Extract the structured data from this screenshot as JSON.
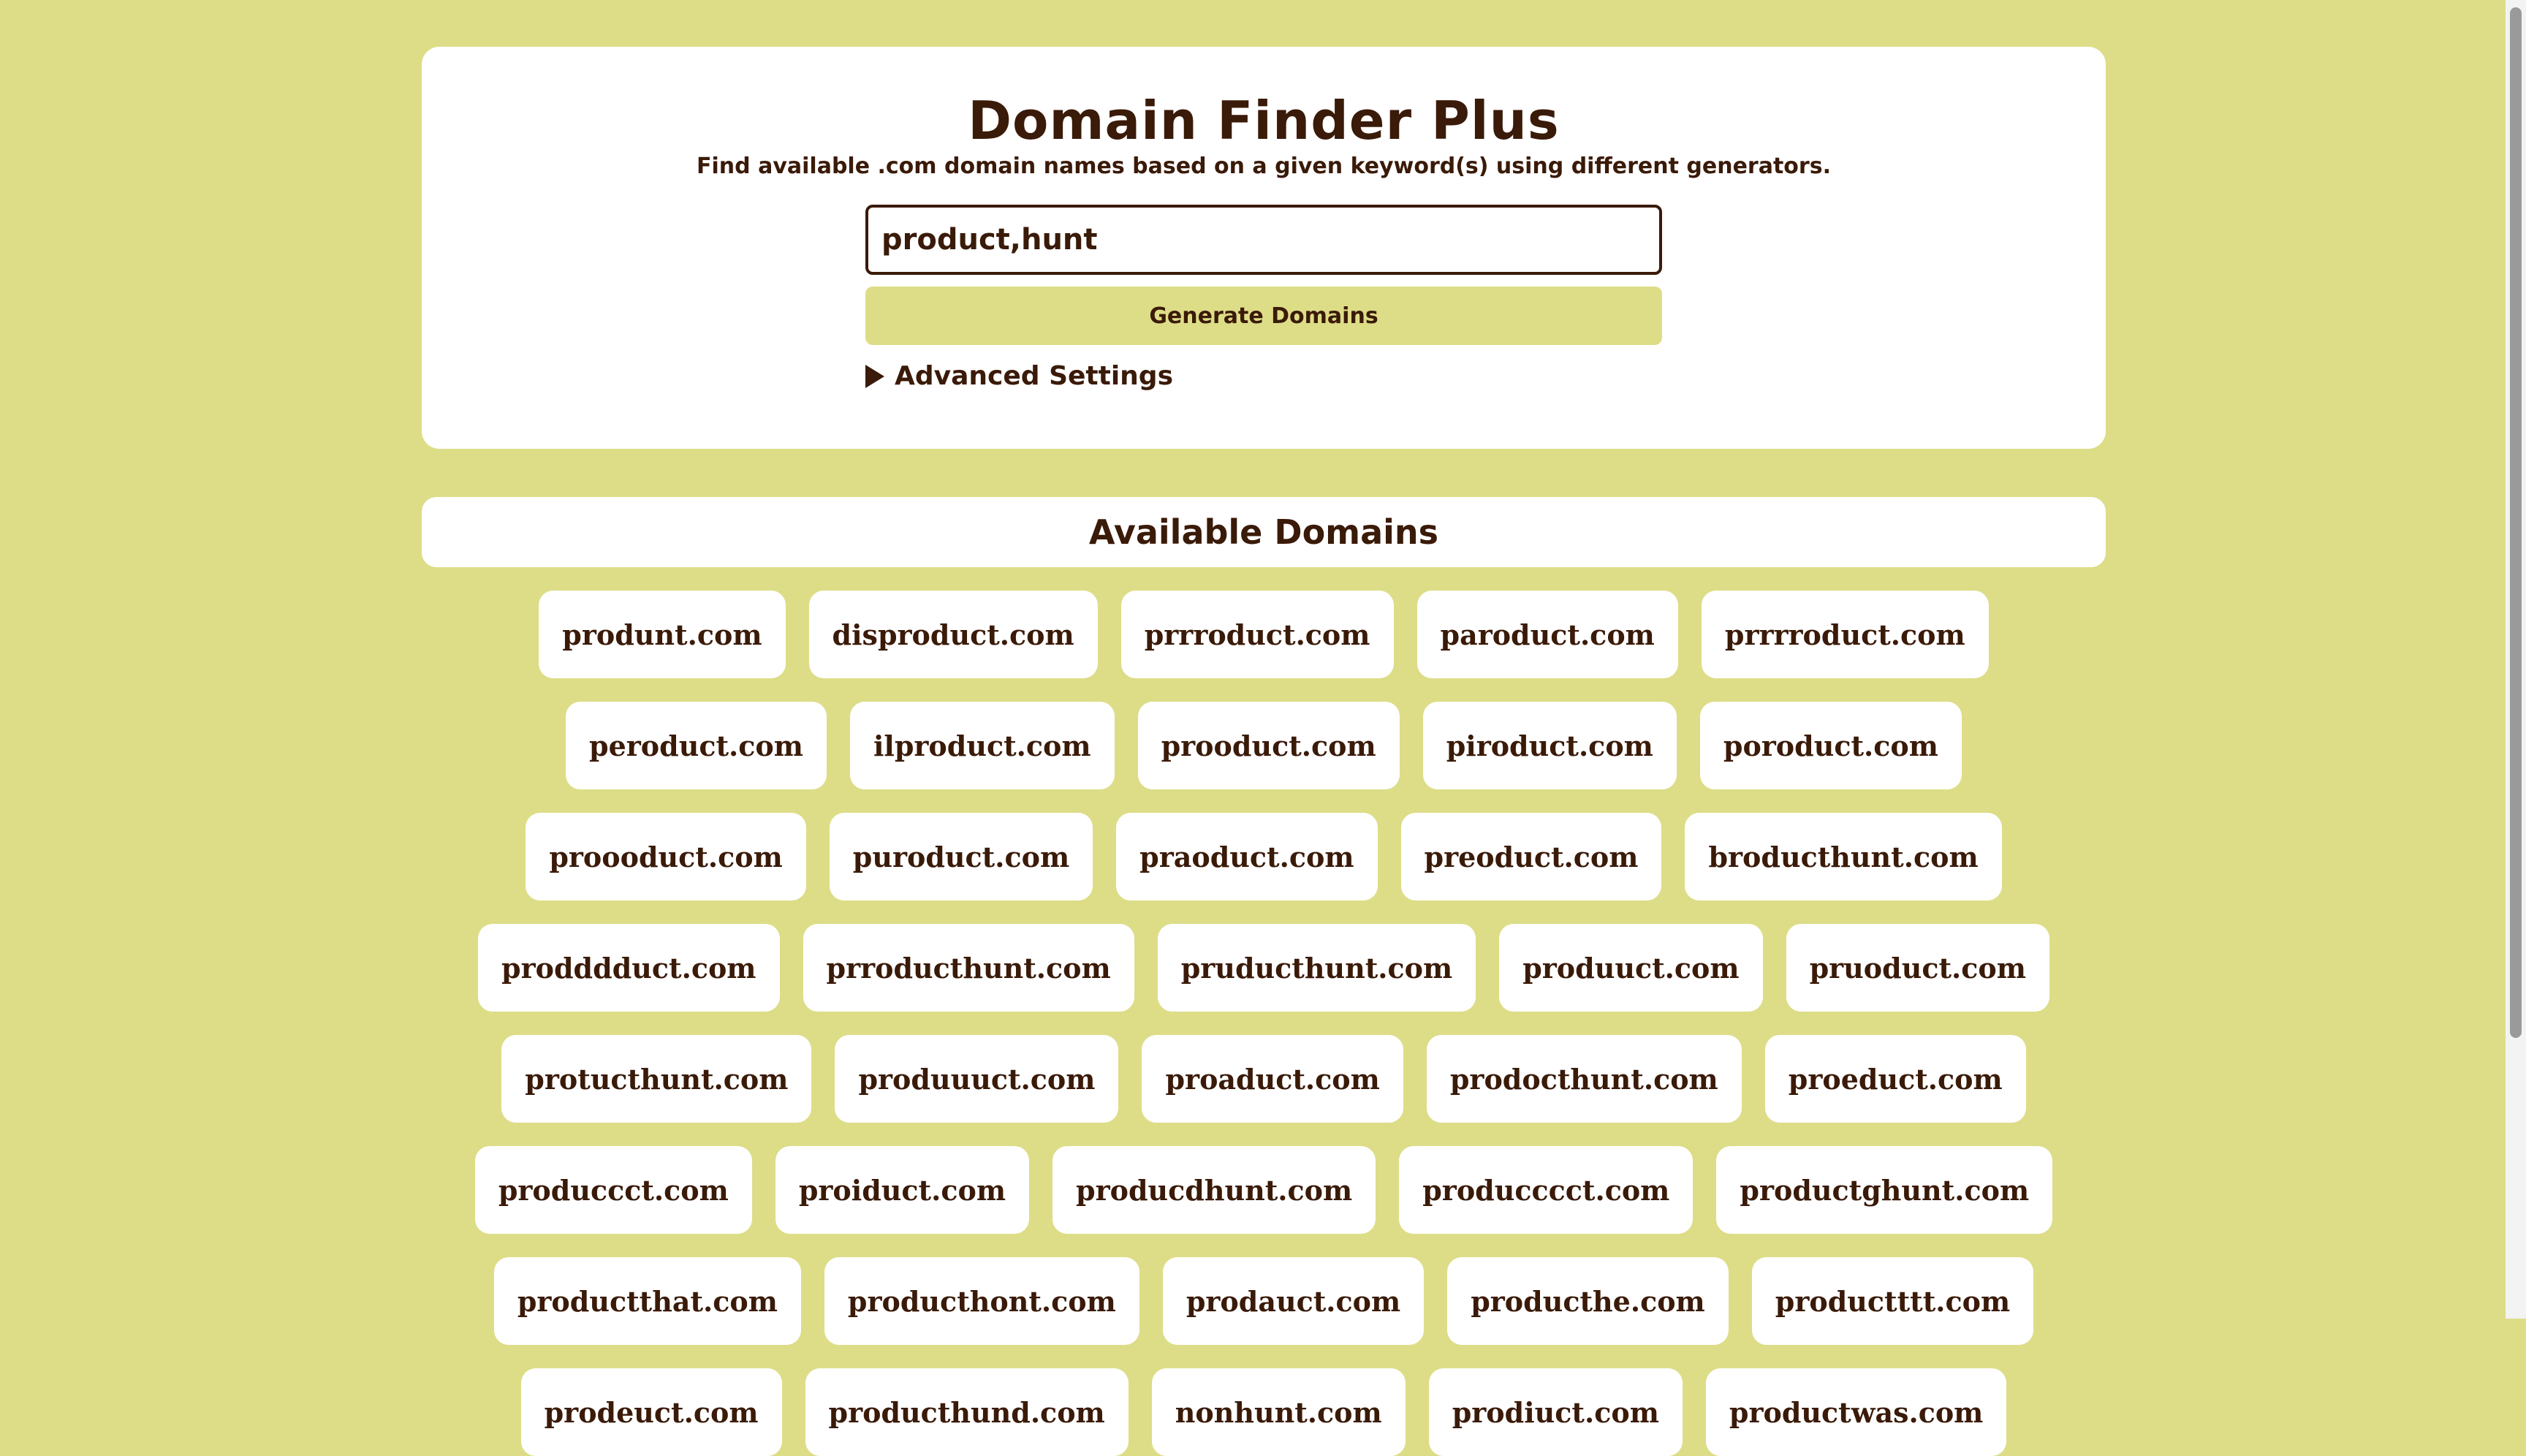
{
  "app": {
    "title": "Domain Finder Plus",
    "subtitle": "Find available .com domain names based on a given keyword(s) using different generators."
  },
  "form": {
    "keyword_value": "product,hunt",
    "generate_label": "Generate Domains",
    "advanced_label": "Advanced Settings"
  },
  "results": {
    "title": "Available Domains",
    "domains": [
      "produnt.com",
      "disproduct.com",
      "prrroduct.com",
      "paroduct.com",
      "prrrroduct.com",
      "peroduct.com",
      "ilproduct.com",
      "prooduct.com",
      "piroduct.com",
      "poroduct.com",
      "proooduct.com",
      "puroduct.com",
      "praoduct.com",
      "preoduct.com",
      "broducthunt.com",
      "prodddduct.com",
      "prroducthunt.com",
      "pruducthunt.com",
      "produuct.com",
      "pruoduct.com",
      "protucthunt.com",
      "produuuct.com",
      "proaduct.com",
      "prodocthunt.com",
      "proeduct.com",
      "produccct.com",
      "proiduct.com",
      "producdhunt.com",
      "producccct.com",
      "productghunt.com",
      "productthat.com",
      "producthont.com",
      "prodauct.com",
      "producthe.com",
      "productttt.com",
      "prodeuct.com",
      "producthund.com",
      "nonhunt.com",
      "prodiuct.com",
      "productwas.com"
    ]
  },
  "colors": {
    "background": "#dddd88",
    "card": "#ffffff",
    "text": "#3a1a08"
  },
  "icons": {
    "advanced_toggle": "triangle-right-icon"
  }
}
